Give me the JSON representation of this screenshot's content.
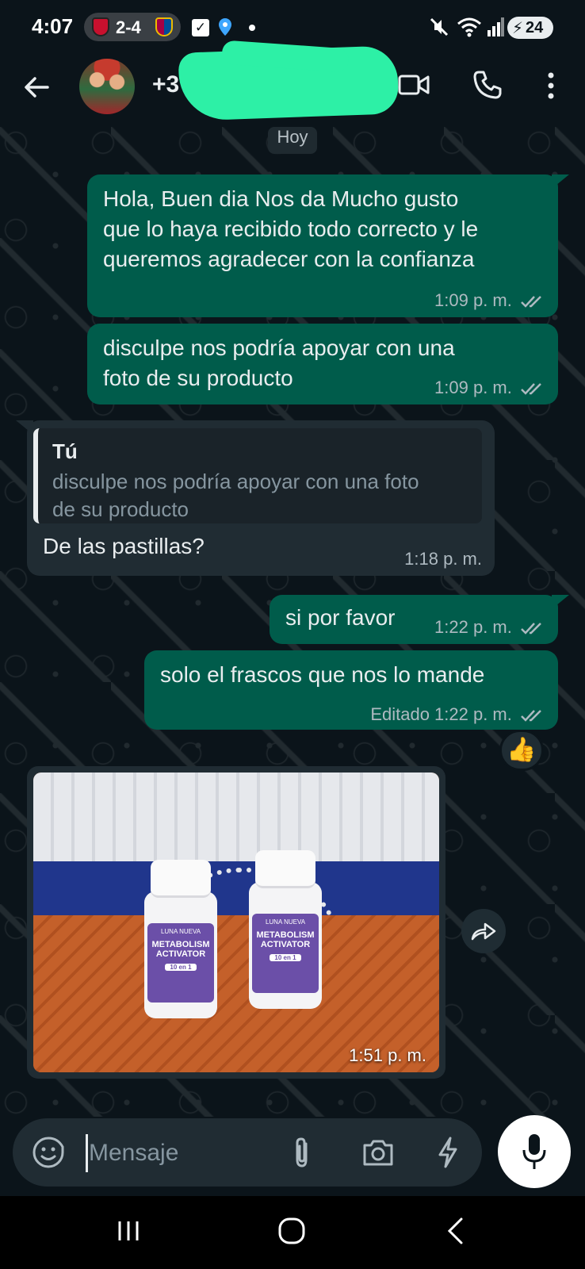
{
  "status_bar": {
    "time": "4:07",
    "score": "2-4",
    "battery": "24"
  },
  "header": {
    "contact_prefix": "+3",
    "icons": [
      "back-arrow-icon",
      "video-call-icon",
      "phone-call-icon",
      "more-options-icon"
    ]
  },
  "chat": {
    "day_label": "Hoy",
    "messages": [
      {
        "direction": "out",
        "lines": [
          "Hola, Buen dia Nos da Mucho gusto",
          "que lo haya recibido todo correcto y le",
          "queremos agradecer con la confianza"
        ],
        "time": "1:09 p. m."
      },
      {
        "direction": "out",
        "lines": [
          "disculpe nos podría apoyar con una",
          "foto de su producto"
        ],
        "time": "1:09 p. m."
      },
      {
        "direction": "in",
        "quote_author": "Tú",
        "quote_lines": [
          "disculpe nos podría apoyar con una foto",
          "de su producto"
        ],
        "text": "De las pastillas?",
        "time": "1:18 p. m."
      },
      {
        "direction": "out",
        "text": "si por favor",
        "time": "1:22 p. m."
      },
      {
        "direction": "out",
        "text": "solo el frascos que nos lo mande",
        "time": "Editado 1:22 p. m.",
        "reaction": "👍"
      },
      {
        "direction": "in",
        "type": "image",
        "time": "1:51 p. m.",
        "bottle_label": {
          "brand": "LUNA NUEVA",
          "name_line1": "METABOLISM",
          "name_line2": "ACTIVATOR",
          "badge": "10 en 1"
        }
      }
    ]
  },
  "input": {
    "placeholder": "Mensaje"
  },
  "colors": {
    "background": "#0b141a",
    "outgoing_bubble": "#005c4b",
    "incoming_bubble": "#202c33",
    "meta_text": "#aebac1",
    "redaction": "#2df0a6"
  }
}
